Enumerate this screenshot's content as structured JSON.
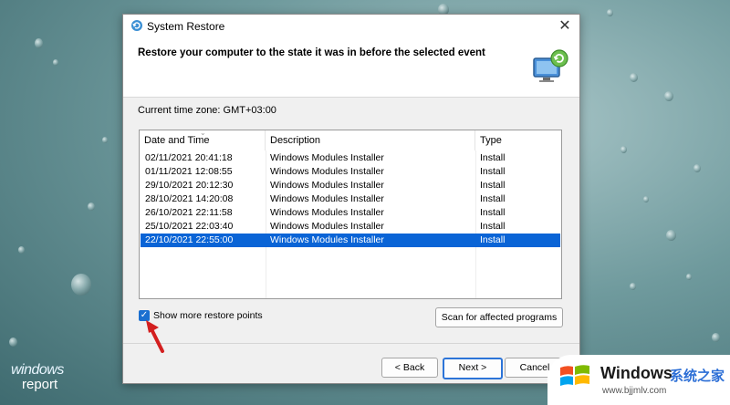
{
  "dialog": {
    "title": "System Restore",
    "close_symbol": "✕",
    "heading": "Restore your computer to the state it was in before the selected event",
    "timezone": "Current time zone: GMT+03:00",
    "table": {
      "headers": [
        "Date and Time",
        "Description",
        "Type"
      ],
      "rows": [
        {
          "date": "02/11/2021 20:41:18",
          "description": "Windows Modules Installer",
          "type": "Install"
        },
        {
          "date": "01/11/2021 12:08:55",
          "description": "Windows Modules Installer",
          "type": "Install"
        },
        {
          "date": "29/10/2021 20:12:30",
          "description": "Windows Modules Installer",
          "type": "Install"
        },
        {
          "date": "28/10/2021 14:20:08",
          "description": "Windows Modules Installer",
          "type": "Install"
        },
        {
          "date": "26/10/2021 22:11:58",
          "description": "Windows Modules Installer",
          "type": "Install"
        },
        {
          "date": "25/10/2021 22:03:40",
          "description": "Windows Modules Installer",
          "type": "Install"
        },
        {
          "date": "22/10/2021 22:55:00",
          "description": "Windows Modules Installer",
          "type": "Install"
        }
      ],
      "selected_row": 6
    },
    "show_more_label": "Show more restore points",
    "show_more_checked": true,
    "scan_button": "Scan for affected programs",
    "back_button": "< Back",
    "next_button": "Next >",
    "cancel_button": "Cancel"
  },
  "watermark_left": {
    "line1": "windows",
    "line2": "report"
  },
  "watermark_right": {
    "brand": "Windows",
    "cn": "系统之家",
    "url": "www.bjjmlv.com"
  },
  "colors": {
    "selection": "#0a64d6",
    "checkbox": "#1a6fd0",
    "arrow": "#d31f1f"
  }
}
